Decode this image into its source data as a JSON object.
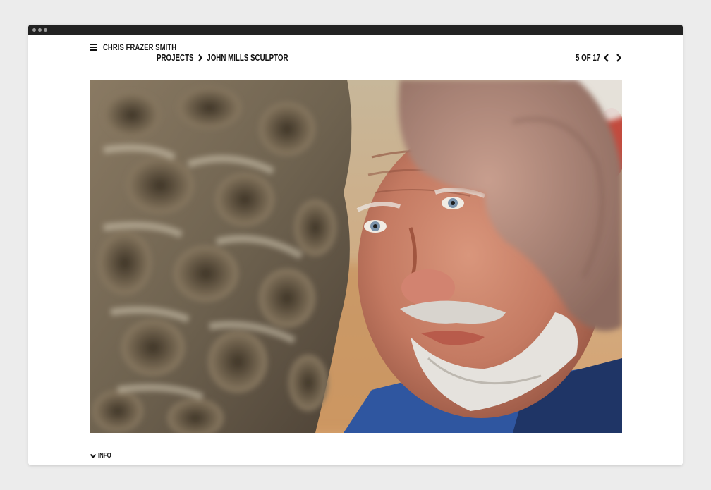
{
  "site": {
    "name": "Chris Frazer Smith"
  },
  "breadcrumb": {
    "section": "Projects",
    "current": "John Mills Sculptor"
  },
  "pager": {
    "text": "5 of 17"
  },
  "info": {
    "label": "Info"
  },
  "icons": {
    "menu": "menu-icon",
    "breadcrumb_separator": "chevron-right-icon",
    "prev": "chevron-left-icon",
    "next": "chevron-right-icon",
    "info_toggle": "chevron-down-icon"
  },
  "colors": {
    "background": "#ececec",
    "window": "#ffffff",
    "titlebar": "#222222",
    "text": "#111111"
  }
}
